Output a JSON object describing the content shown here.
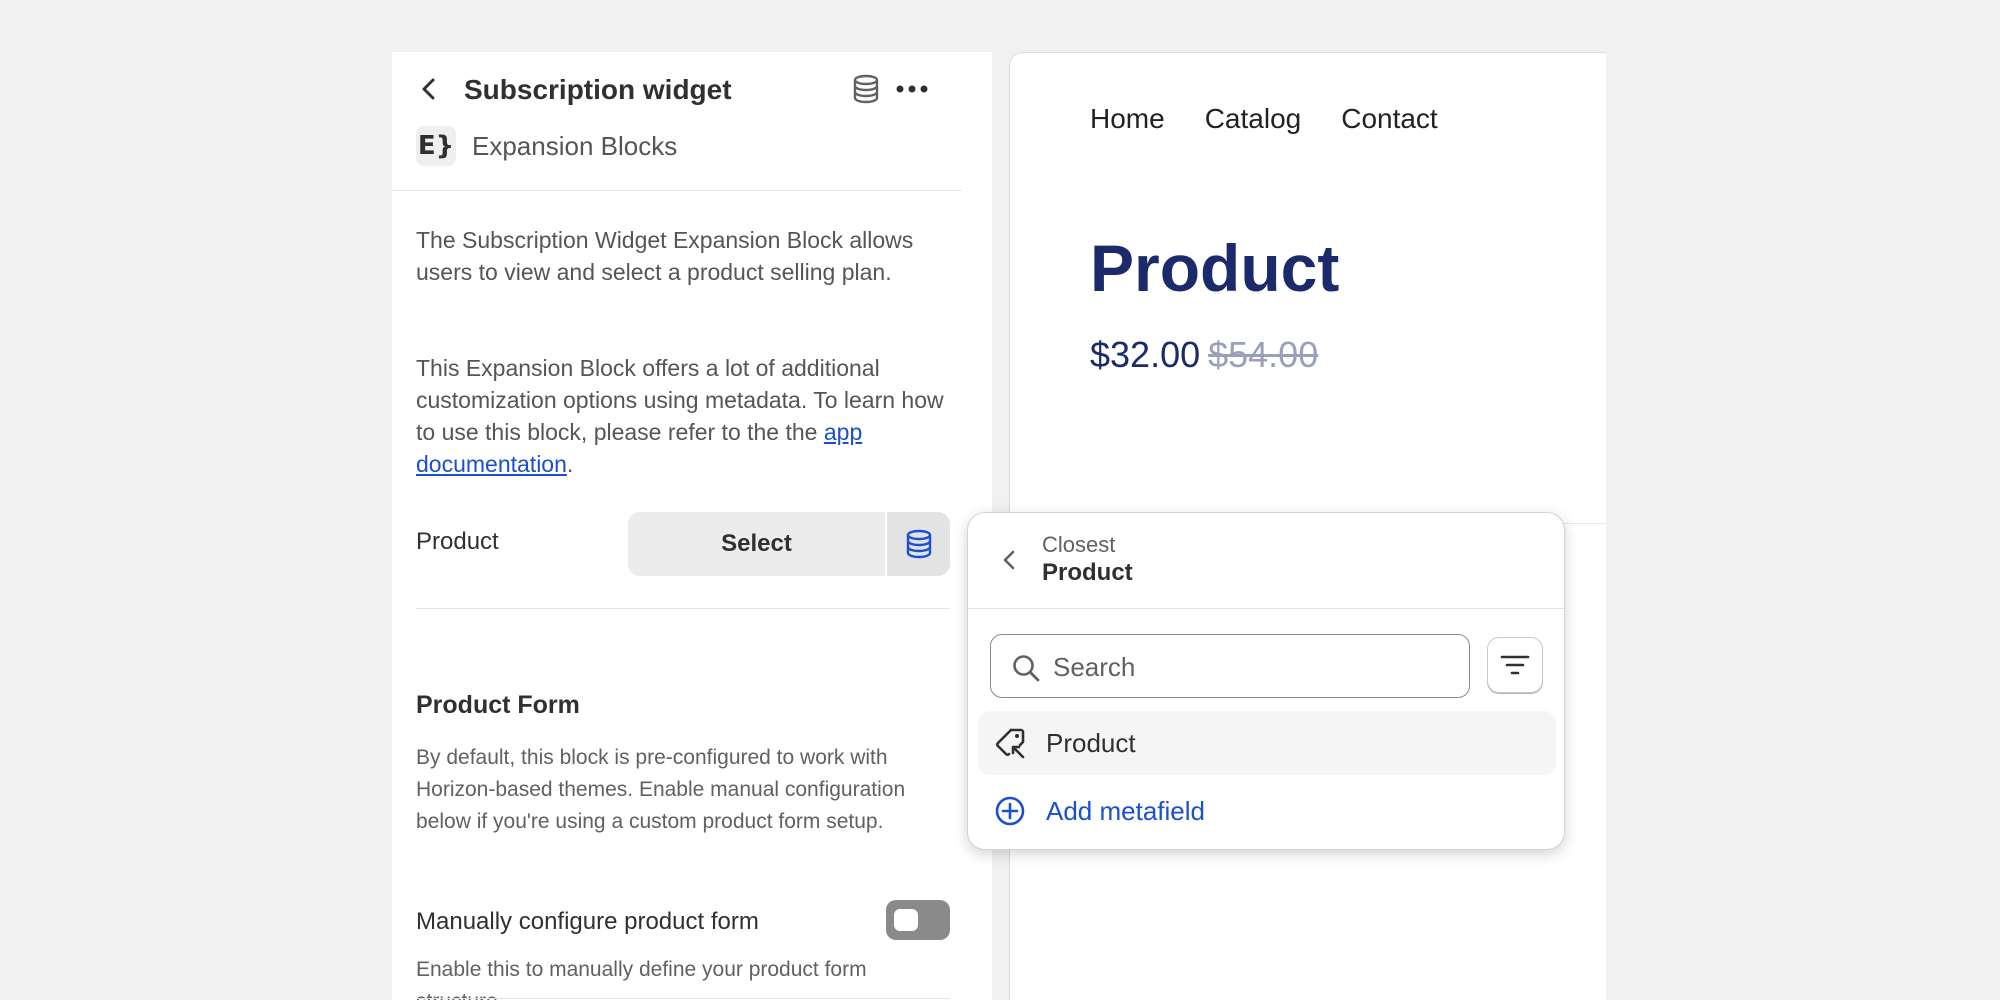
{
  "panel": {
    "title": "Subscription widget",
    "app_logo_text": "E}",
    "app_name": "Expansion Blocks",
    "description_1": "The Subscription Widget Expansion Block allows users to view and select a product selling plan.",
    "description_2_prefix": "This Expansion Block offers a lot of additional customization options using metadata. To learn how to use this block, please refer to the the ",
    "description_2_link": "app documentation",
    "description_2_suffix": ".",
    "product_field": {
      "label": "Product",
      "select_label": "Select"
    },
    "product_form": {
      "title": "Product Form",
      "description": "By default, this block is pre-configured to work with Horizon-based themes. Enable manual configuration below if you're using a custom product form setup.",
      "toggle_label": "Manually configure product form",
      "toggle_on": false,
      "toggle_help": "Enable this to manually define your product form structure."
    }
  },
  "preview": {
    "nav": [
      "Home",
      "Catalog",
      "Contact"
    ],
    "product_title": "Product",
    "price": "$32.00",
    "compare_price": "$54.00"
  },
  "popover": {
    "breadcrumb": "Closest",
    "title": "Product",
    "search_placeholder": "Search",
    "results": [
      {
        "label": "Product",
        "icon": "product-tag-icon"
      }
    ],
    "add_label": "Add metafield"
  },
  "colors": {
    "accent_blue": "#1a4fd1",
    "product_navy": "#1b2a6b",
    "compare_price": "#9aa0b9",
    "toggle_off": "#8a8a8a"
  }
}
